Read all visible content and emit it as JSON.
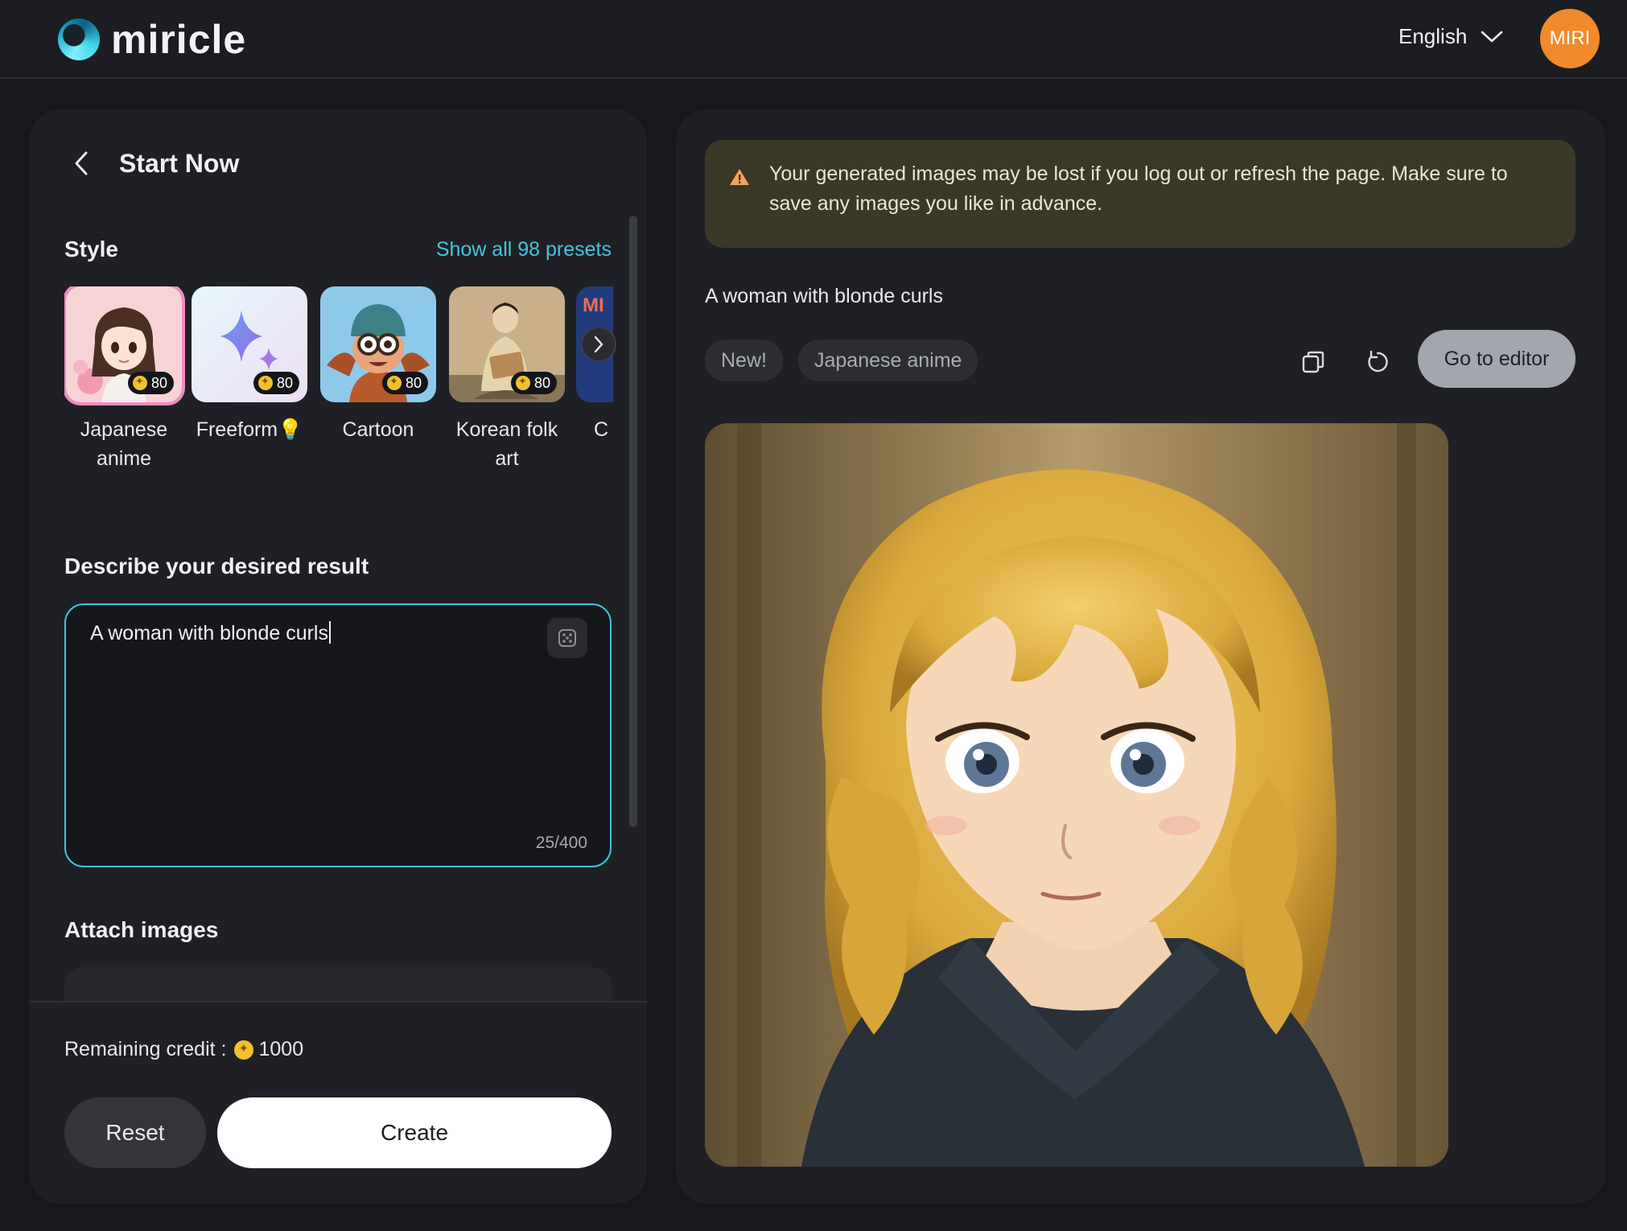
{
  "header": {
    "logo_text": "miricle",
    "language": "English",
    "avatar_initials": "MIRI"
  },
  "left": {
    "back_title": "Start Now",
    "style_title": "Style",
    "show_all": "Show all 98 presets",
    "presets": [
      {
        "label": "Japanese anime",
        "cost": "80",
        "selected": true
      },
      {
        "label": "Freeform",
        "cost": "80",
        "selected": false
      },
      {
        "label": "Cartoon",
        "cost": "80",
        "selected": false
      },
      {
        "label": "Korean folk art",
        "cost": "80",
        "selected": false
      },
      {
        "label": "C",
        "thumb_text": "MI"
      }
    ],
    "describe_title": "Describe your desired result",
    "prompt_value": "A woman with blonde curls",
    "char_count": "25/400",
    "attach_title": "Attach images",
    "remaining_credit_label": "Remaining credit :",
    "remaining_credit_value": "1000",
    "reset_label": "Reset",
    "create_label": "Create"
  },
  "right": {
    "notice": "Your generated images may be lost if you log out or refresh the page. Make sure to save any images you like in advance.",
    "result_prompt": "A woman with blonde curls",
    "tags": [
      "New!",
      "Japanese anime"
    ],
    "editor_label": "Go to editor"
  },
  "colors": {
    "accent": "#46c4de",
    "avatar": "#f08a2c",
    "notice_bg": "#3a3826",
    "coin": "#f3c12d"
  },
  "icons": [
    "chevron-left-icon",
    "chevron-down-icon",
    "chevron-right-icon",
    "coin-icon",
    "lightbulb-icon",
    "dice-icon",
    "warning-icon",
    "copy-icon",
    "refresh-icon"
  ]
}
